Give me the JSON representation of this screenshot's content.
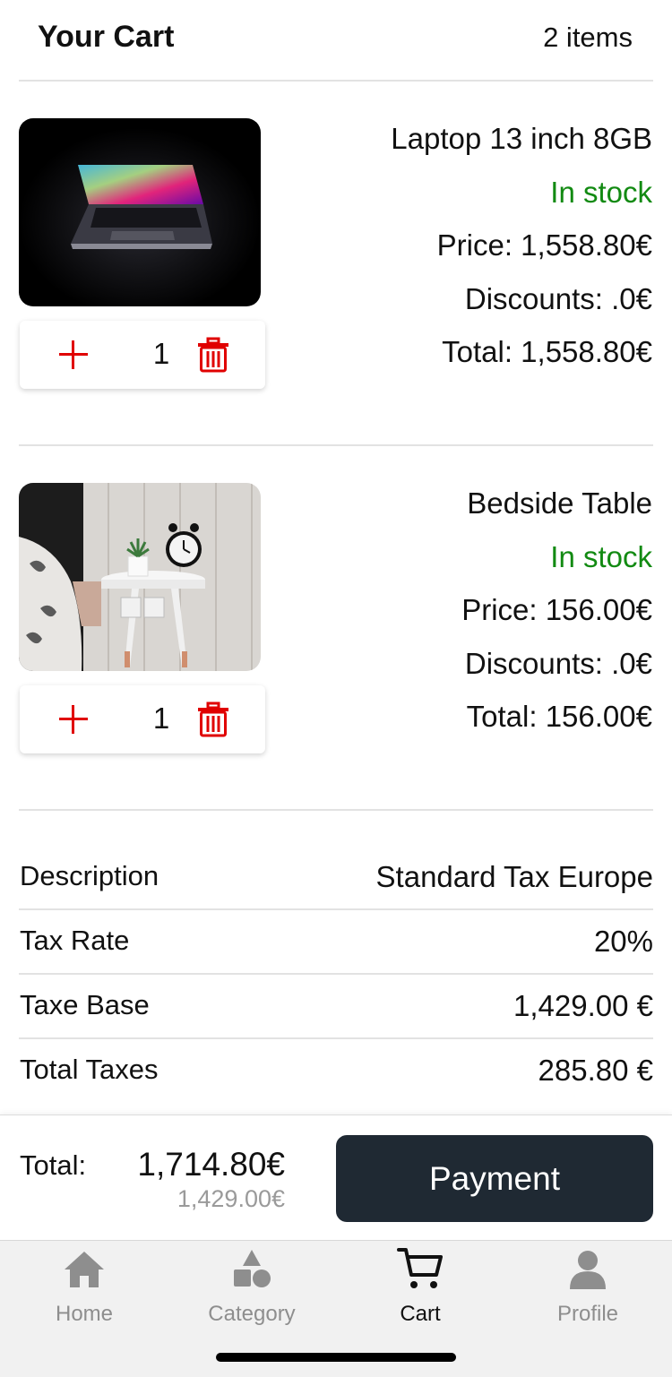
{
  "header": {
    "title": "Your Cart",
    "count": "2 items"
  },
  "cart": {
    "items": [
      {
        "name": "Laptop 13 inch 8GB",
        "stock": "In stock",
        "price": "Price: 1,558.80€",
        "discounts": "Discounts: .0€",
        "total": "Total: 1,558.80€",
        "quantity": "1"
      },
      {
        "name": "Bedside Table",
        "stock": "In stock",
        "price": "Price: 156.00€",
        "discounts": "Discounts: .0€",
        "total": "Total: 156.00€",
        "quantity": "1"
      }
    ]
  },
  "tax": {
    "rows": [
      {
        "label": "Description",
        "value": "Standard Tax Europe"
      },
      {
        "label": "Tax Rate",
        "value": "20%"
      },
      {
        "label": "Taxe Base",
        "value": "1,429.00 €"
      },
      {
        "label": "Total Taxes",
        "value": "285.80 €"
      }
    ]
  },
  "footer": {
    "total_label": "Total:",
    "total_value": "1,714.80€",
    "subtotal_value": "1,429.00€",
    "payment_label": "Payment"
  },
  "tabs": [
    {
      "label": "Home",
      "icon": "home-icon"
    },
    {
      "label": "Category",
      "icon": "category-icon"
    },
    {
      "label": "Cart",
      "icon": "cart-icon",
      "active": true
    },
    {
      "label": "Profile",
      "icon": "profile-icon"
    }
  ],
  "colors": {
    "stock": "#128a12",
    "accent": "#e00000",
    "button": "#1f2933",
    "tab_inactive": "#8e8e8e"
  }
}
